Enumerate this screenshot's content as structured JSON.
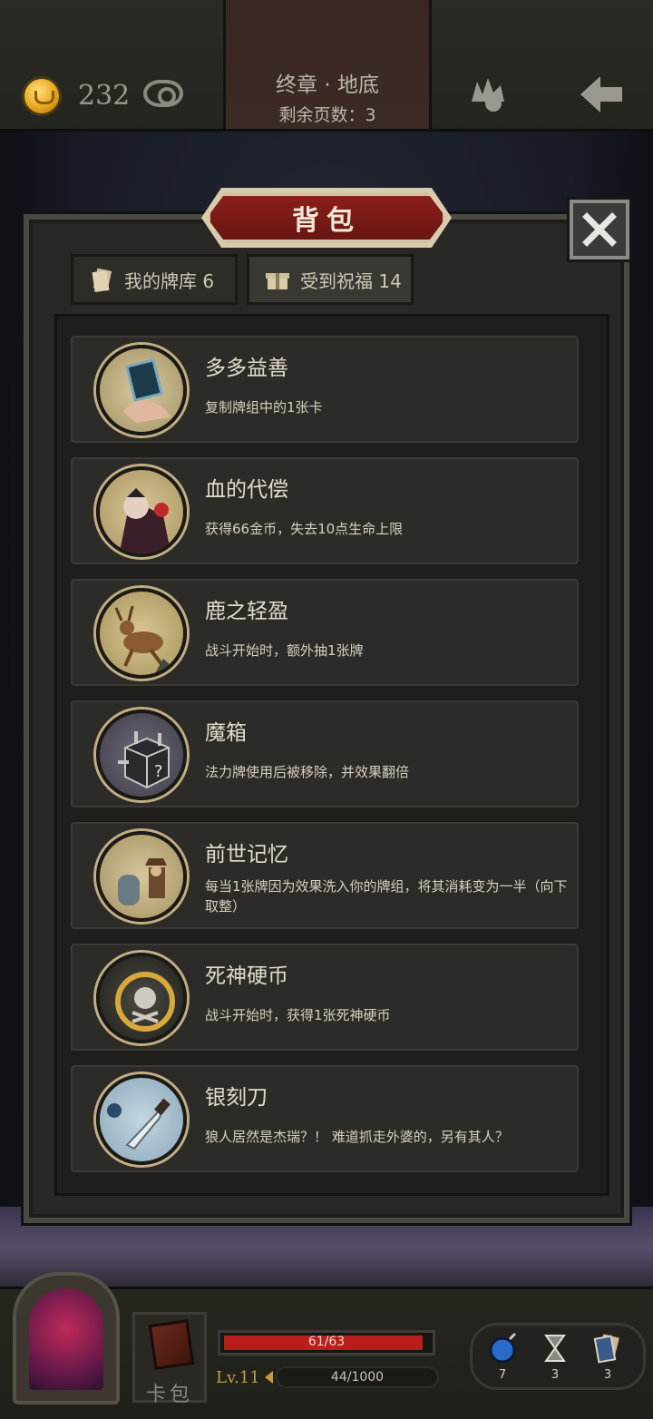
{
  "header": {
    "gold": "232",
    "chapter_title": "终章 · 地底",
    "pages_left": "剩余页数：3"
  },
  "panel": {
    "title": "背包",
    "tabs": [
      {
        "label": "我的牌库 6"
      },
      {
        "label": "受到祝福 14"
      }
    ]
  },
  "items": [
    {
      "title": "多多益善",
      "desc": "复制牌组中的1张卡",
      "art": "copy-card-icon"
    },
    {
      "title": "血的代偿",
      "desc": "获得66金币，失去10点生命上限",
      "art": "vampire-icon"
    },
    {
      "title": "鹿之轻盈",
      "desc": "战斗开始时，额外抽1张牌",
      "art": "deer-icon"
    },
    {
      "title": "魔箱",
      "desc": "法力牌使用后被移除，并效果翻倍",
      "art": "magic-box-icon"
    },
    {
      "title": "前世记忆",
      "desc": "每当1张牌因为效果洗入你的牌组，将其消耗变为一半（向下取整）",
      "art": "hunter-grave-icon"
    },
    {
      "title": "死神硬币",
      "desc": "战斗开始时，获得1张死神硬币",
      "art": "death-coin-icon"
    },
    {
      "title": "银刻刀",
      "desc": "狼人居然是杰瑞？！ 难道抓走外婆的，另有其人？",
      "art": "silver-knife-icon"
    }
  ],
  "footer": {
    "deck_label": "卡包",
    "hp_text": "61/63",
    "hp_fraction": 0.968,
    "level": "Lv.11",
    "xp_text": "44/1000",
    "resources": [
      {
        "icon": "bomb-icon",
        "count": "7"
      },
      {
        "icon": "hourglass-icon",
        "count": "3"
      },
      {
        "icon": "card-stack-icon",
        "count": "3"
      }
    ]
  },
  "colors": {
    "accent_red": "#8a1f1c",
    "gold": "#e7a81e",
    "frame": "#c0ae84"
  }
}
